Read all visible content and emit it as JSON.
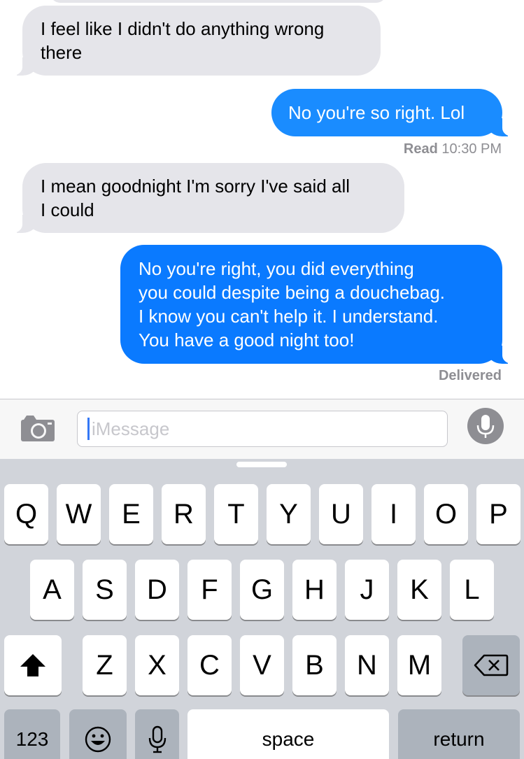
{
  "messages": [
    {
      "side": "received",
      "text": "I feel like I didn't do anything wrong\nthere"
    },
    {
      "side": "sent",
      "text": "No you're so right. Lol"
    },
    {
      "side": "received",
      "text": "I mean goodnight I'm sorry I've said all\nI could"
    },
    {
      "side": "sent",
      "text": "No you're right, you did everything\nyou could despite being a douchebag.\nI know you can't help it. I understand.\nYou have a good night too!"
    }
  ],
  "receipts": {
    "read_label": "Read",
    "read_time": "10:30 PM",
    "delivered": "Delivered"
  },
  "input": {
    "placeholder": "iMessage",
    "camera_icon": "camera-icon",
    "mic_icon": "microphone-icon"
  },
  "keyboard": {
    "row1": [
      "Q",
      "W",
      "E",
      "R",
      "T",
      "Y",
      "U",
      "I",
      "O",
      "P"
    ],
    "row2": [
      "A",
      "S",
      "D",
      "F",
      "G",
      "H",
      "J",
      "K",
      "L"
    ],
    "row3": [
      "Z",
      "X",
      "C",
      "V",
      "B",
      "N",
      "M"
    ],
    "numbers_label": "123",
    "space_label": "space",
    "return_label": "return",
    "shift_icon": "shift-arrow-icon",
    "delete_icon": "backspace-icon",
    "emoji_icon": "emoji-icon",
    "dictation_icon": "microphone-icon"
  },
  "colors": {
    "sent_bubble": "#1a8cff",
    "received_bubble": "#e5e5ea",
    "keyboard_bg": "#d1d4da"
  }
}
